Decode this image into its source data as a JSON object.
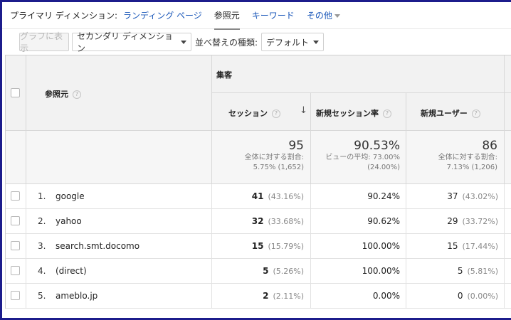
{
  "primary_dimension": {
    "label": "プライマリ ディメンション:",
    "options": [
      {
        "label": "ランディング ページ",
        "active": false
      },
      {
        "label": "参照元",
        "active": true
      },
      {
        "label": "キーワード",
        "active": false
      }
    ],
    "other_label": "その他"
  },
  "toolbar": {
    "graph_button": "グラフに表示",
    "secondary_dimension": "セカンダリ ディメンション",
    "sort_type_label": "並べ替えの種類:",
    "sort_type_value": "デフォルト"
  },
  "table": {
    "header": {
      "dimension": "参照元",
      "group": "集客",
      "columns": [
        "セッション",
        "新規セッション率",
        "新規ユーザー"
      ]
    },
    "totals": {
      "sessions": {
        "value": "95",
        "line1": "全体に対する割合:",
        "line2": "5.75% (1,652)"
      },
      "new_session_rate": {
        "value": "90.53%",
        "line1": "ビューの平均: 73.00%",
        "line2": "(24.00%)"
      },
      "new_users": {
        "value": "86",
        "line1": "全体に対する割合:",
        "line2": "7.13% (1,206)"
      }
    },
    "rows": [
      {
        "index": "1.",
        "source": "google",
        "sessions": "41",
        "sessions_pct": "(43.16%)",
        "new_session_rate": "90.24%",
        "new_users": "37",
        "new_users_pct": "(43.02%)"
      },
      {
        "index": "2.",
        "source": "yahoo",
        "sessions": "32",
        "sessions_pct": "(33.68%)",
        "new_session_rate": "90.62%",
        "new_users": "29",
        "new_users_pct": "(33.72%)"
      },
      {
        "index": "3.",
        "source": "search.smt.docomo",
        "sessions": "15",
        "sessions_pct": "(15.79%)",
        "new_session_rate": "100.00%",
        "new_users": "15",
        "new_users_pct": "(17.44%)"
      },
      {
        "index": "4.",
        "source": "(direct)",
        "sessions": "5",
        "sessions_pct": "(5.26%)",
        "new_session_rate": "100.00%",
        "new_users": "5",
        "new_users_pct": "(5.81%)"
      },
      {
        "index": "5.",
        "source": "ameblo.jp",
        "sessions": "2",
        "sessions_pct": "(2.11%)",
        "new_session_rate": "0.00%",
        "new_users": "0",
        "new_users_pct": "(0.00%)"
      }
    ]
  }
}
